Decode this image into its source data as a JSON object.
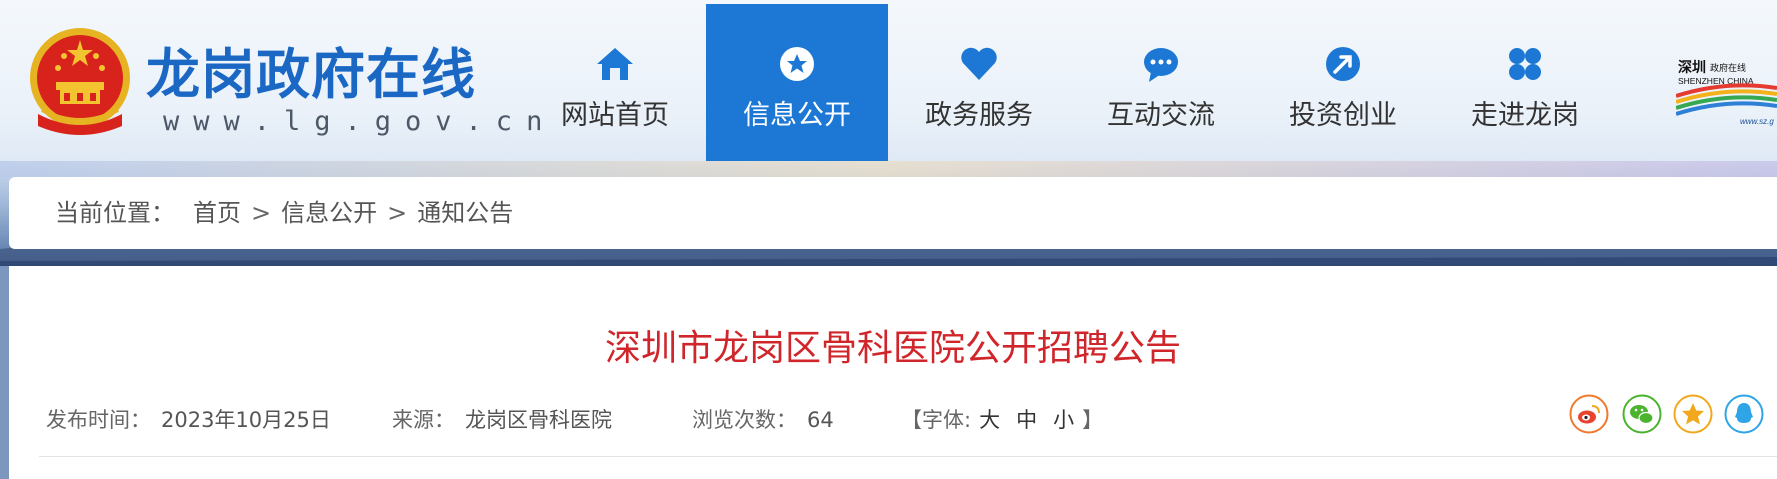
{
  "header": {
    "site_title": "龙岗政府在线",
    "site_url": "www.lg.gov.cn",
    "emblem_icon": "national-emblem-icon",
    "partner_logo": {
      "name": "shenzhen-government-online-logo",
      "text_cn": "深圳",
      "text_cn2": "政府在线",
      "text_en": "SHENZHEN CHINA",
      "url": "www.sz.g"
    }
  },
  "nav": [
    {
      "label": "网站首页",
      "icon": "home-icon",
      "active": false
    },
    {
      "label": "信息公开",
      "icon": "star-circle-icon",
      "active": true
    },
    {
      "label": "政务服务",
      "icon": "heart-icon",
      "active": false
    },
    {
      "label": "互动交流",
      "icon": "chat-bubble-icon",
      "active": false
    },
    {
      "label": "投资创业",
      "icon": "arrow-circle-icon",
      "active": false
    },
    {
      "label": "走进龙岗",
      "icon": "four-leaf-icon",
      "active": false
    }
  ],
  "breadcrumb": {
    "label": "当前位置：",
    "items": [
      "首页",
      "信息公开",
      "通知公告"
    ],
    "separator": ">"
  },
  "article": {
    "title": "深圳市龙岗区骨科医院公开招聘公告",
    "publish_label": "发布时间：",
    "publish_date": "2023年10月25日",
    "source_label": "来源：",
    "source": "龙岗区骨科医院",
    "views_label": "浏览次数：",
    "views": "64",
    "font_label": "【字体:",
    "font_sizes": [
      "大",
      "中",
      "小"
    ],
    "font_close": "】"
  },
  "share": [
    {
      "icon": "weibo-icon",
      "color": "#ef7a2e"
    },
    {
      "icon": "wechat-icon",
      "color": "#4cb32f"
    },
    {
      "icon": "favorite-star-icon",
      "color": "#f2a81d"
    },
    {
      "icon": "qq-icon",
      "color": "#2fa4e7"
    }
  ],
  "colors": {
    "brand_blue": "#1c78d4",
    "title_red": "#d0262b"
  }
}
